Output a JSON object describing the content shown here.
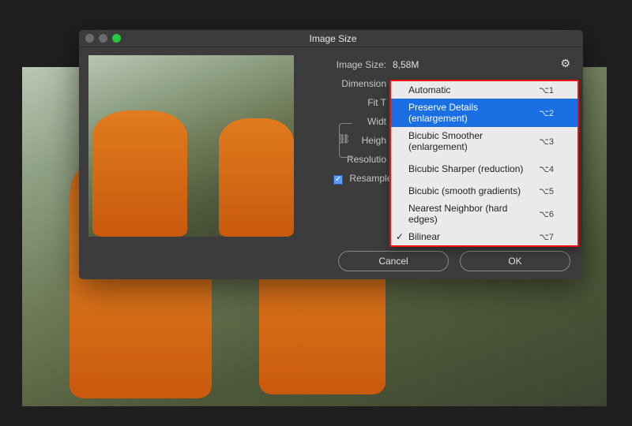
{
  "dialog": {
    "title": "Image Size",
    "image_size_label": "Image Size:",
    "image_size_value": "8,58M",
    "dimensions_label": "Dimension",
    "fit_to_label": "Fit T",
    "width_label": "Widt",
    "height_label": "Heigh",
    "resolution_label": "Resolutio",
    "resample_label": "Resample",
    "cancel": "Cancel",
    "ok": "OK"
  },
  "dropdown": {
    "items": [
      {
        "label": "Automatic",
        "shortcut": "⌥1",
        "highlight": false,
        "checked": false
      },
      {
        "label": "Preserve Details (enlargement)",
        "shortcut": "⌥2",
        "highlight": true,
        "checked": false
      },
      {
        "label": "Bicubic Smoother (enlargement)",
        "shortcut": "⌥3",
        "highlight": false,
        "checked": false
      },
      {
        "label": "Bicubic Sharper (reduction)",
        "shortcut": "⌥4",
        "highlight": false,
        "checked": false
      },
      {
        "label": "Bicubic (smooth gradients)",
        "shortcut": "⌥5",
        "highlight": false,
        "checked": false
      },
      {
        "label": "Nearest Neighbor (hard edges)",
        "shortcut": "⌥6",
        "highlight": false,
        "checked": false
      },
      {
        "label": "Bilinear",
        "shortcut": "⌥7",
        "highlight": false,
        "checked": true
      }
    ]
  }
}
